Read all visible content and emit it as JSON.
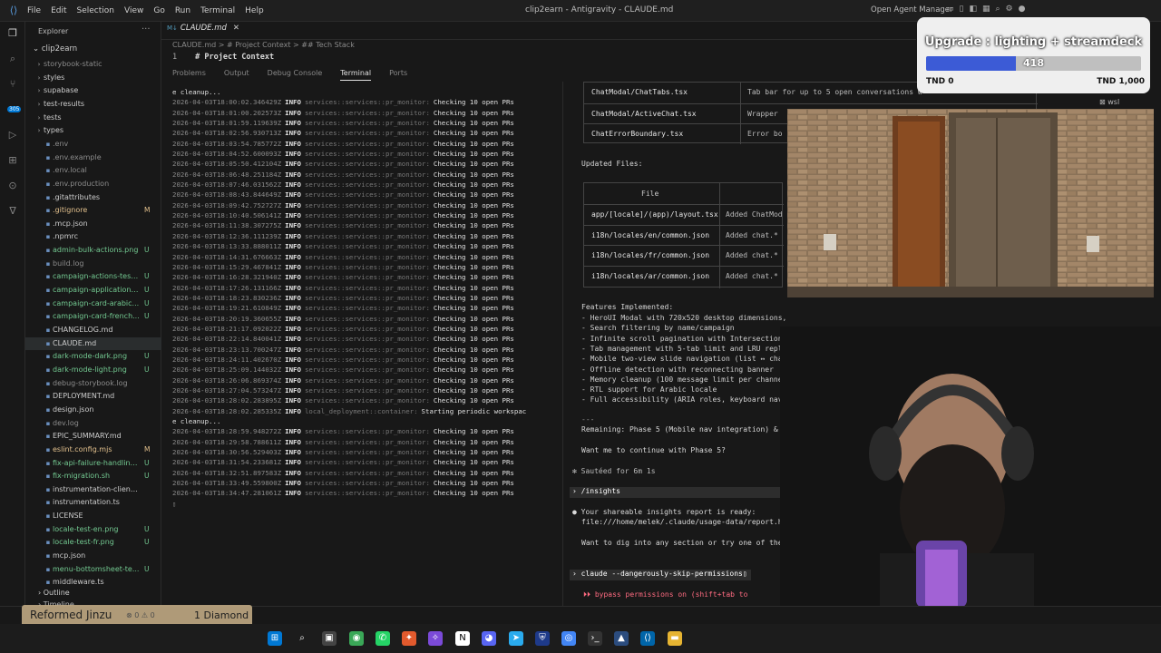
{
  "titlebar": {
    "menu": [
      "File",
      "Edit",
      "Selection",
      "View",
      "Go",
      "Run",
      "Terminal",
      "Help"
    ],
    "window_title": "clip2earn - Antigravity - CLAUDE.md",
    "open_agent_manager": "Open Agent Manager"
  },
  "activity": {
    "badge": "305"
  },
  "sidebar": {
    "header": "Explorer",
    "root": "clip2earn",
    "items": [
      {
        "label": "storybook-static",
        "kind": "folder",
        "status": ""
      },
      {
        "label": "styles",
        "kind": "folder",
        "status": ""
      },
      {
        "label": "supabase",
        "kind": "folder",
        "status": ""
      },
      {
        "label": "test-results",
        "kind": "folder",
        "status": ""
      },
      {
        "label": "tests",
        "kind": "folder",
        "status": ""
      },
      {
        "label": "types",
        "kind": "folder",
        "status": ""
      },
      {
        "label": ".env",
        "kind": "file",
        "status": ""
      },
      {
        "label": ".env.example",
        "kind": "file",
        "status": ""
      },
      {
        "label": ".env.local",
        "kind": "file",
        "status": ""
      },
      {
        "label": ".env.production",
        "kind": "file",
        "status": ""
      },
      {
        "label": ".gitattributes",
        "kind": "file",
        "status": ""
      },
      {
        "label": ".gitignore",
        "kind": "file",
        "status": "M"
      },
      {
        "label": ".mcp.json",
        "kind": "file",
        "status": ""
      },
      {
        "label": ".npmrc",
        "kind": "file",
        "status": ""
      },
      {
        "label": "admin-bulk-actions.png",
        "kind": "file",
        "status": "U"
      },
      {
        "label": "build.log",
        "kind": "file",
        "status": ""
      },
      {
        "label": "campaign-actions-test...",
        "kind": "file",
        "status": "U"
      },
      {
        "label": "campaign-application-...",
        "kind": "file",
        "status": "U"
      },
      {
        "label": "campaign-card-arabic...",
        "kind": "file",
        "status": "U"
      },
      {
        "label": "campaign-card-french...",
        "kind": "file",
        "status": "U"
      },
      {
        "label": "CHANGELOG.md",
        "kind": "file",
        "status": ""
      },
      {
        "label": "CLAUDE.md",
        "kind": "file",
        "status": ""
      },
      {
        "label": "dark-mode-dark.png",
        "kind": "file",
        "status": "U"
      },
      {
        "label": "dark-mode-light.png",
        "kind": "file",
        "status": "U"
      },
      {
        "label": "debug-storybook.log",
        "kind": "file",
        "status": ""
      },
      {
        "label": "DEPLOYMENT.md",
        "kind": "file",
        "status": ""
      },
      {
        "label": "design.json",
        "kind": "file",
        "status": ""
      },
      {
        "label": "dev.log",
        "kind": "file",
        "status": ""
      },
      {
        "label": "EPIC_SUMMARY.md",
        "kind": "file",
        "status": ""
      },
      {
        "label": "eslint.config.mjs",
        "kind": "file",
        "status": "M"
      },
      {
        "label": "fix-api-failure-handling.md",
        "kind": "file",
        "status": "U"
      },
      {
        "label": "fix-migration.sh",
        "kind": "file",
        "status": "U"
      },
      {
        "label": "instrumentation-client.ts",
        "kind": "file",
        "status": ""
      },
      {
        "label": "instrumentation.ts",
        "kind": "file",
        "status": ""
      },
      {
        "label": "LICENSE",
        "kind": "file",
        "status": ""
      },
      {
        "label": "locale-test-en.png",
        "kind": "file",
        "status": "U"
      },
      {
        "label": "locale-test-fr.png",
        "kind": "file",
        "status": "U"
      },
      {
        "label": "mcp.json",
        "kind": "file",
        "status": ""
      },
      {
        "label": "menu-bottomsheet-te...",
        "kind": "file",
        "status": "U"
      },
      {
        "label": "middleware.ts",
        "kind": "file",
        "status": ""
      }
    ],
    "outline": "Outline",
    "timeline": "Timeline"
  },
  "editor": {
    "tab": "CLAUDE.md",
    "breadcrumb": "CLAUDE.md  >  # Project Context  >  ## Tech Stack",
    "line_no": "1",
    "line_text": "# Project Context"
  },
  "panel": {
    "tabs": [
      "Problems",
      "Output",
      "Debug Console",
      "Terminal",
      "Ports"
    ],
    "log_lines": [
      {
        "plain": "e cleanup..."
      },
      {
        "ts": "2026-04-03T18:00:02.346429Z",
        "lvl": "INFO",
        "mod": "services::services::pr_monitor:",
        "msg": "Checking 10 open PRs"
      },
      {
        "ts": "2026-04-03T18:01:00.202573Z",
        "lvl": "INFO",
        "mod": "services::services::pr_monitor:",
        "msg": "Checking 10 open PRs"
      },
      {
        "ts": "2026-04-03T18:01:59.119639Z",
        "lvl": "INFO",
        "mod": "services::services::pr_monitor:",
        "msg": "Checking 10 open PRs"
      },
      {
        "ts": "2026-04-03T18:02:56.930713Z",
        "lvl": "INFO",
        "mod": "services::services::pr_monitor:",
        "msg": "Checking 10 open PRs"
      },
      {
        "ts": "2026-04-03T18:03:54.785772Z",
        "lvl": "INFO",
        "mod": "services::services::pr_monitor:",
        "msg": "Checking 10 open PRs"
      },
      {
        "ts": "2026-04-03T18:04:52.600093Z",
        "lvl": "INFO",
        "mod": "services::services::pr_monitor:",
        "msg": "Checking 10 open PRs"
      },
      {
        "ts": "2026-04-03T18:05:50.412104Z",
        "lvl": "INFO",
        "mod": "services::services::pr_monitor:",
        "msg": "Checking 10 open PRs"
      },
      {
        "ts": "2026-04-03T18:06:48.251184Z",
        "lvl": "INFO",
        "mod": "services::services::pr_monitor:",
        "msg": "Checking 10 open PRs"
      },
      {
        "ts": "2026-04-03T18:07:46.031562Z",
        "lvl": "INFO",
        "mod": "services::services::pr_monitor:",
        "msg": "Checking 10 open PRs"
      },
      {
        "ts": "2026-04-03T18:08:43.844649Z",
        "lvl": "INFO",
        "mod": "services::services::pr_monitor:",
        "msg": "Checking 10 open PRs"
      },
      {
        "ts": "2026-04-03T18:09:42.752727Z",
        "lvl": "INFO",
        "mod": "services::services::pr_monitor:",
        "msg": "Checking 10 open PRs"
      },
      {
        "ts": "2026-04-03T18:10:40.506141Z",
        "lvl": "INFO",
        "mod": "services::services::pr_monitor:",
        "msg": "Checking 10 open PRs"
      },
      {
        "ts": "2026-04-03T18:11:38.307275Z",
        "lvl": "INFO",
        "mod": "services::services::pr_monitor:",
        "msg": "Checking 10 open PRs"
      },
      {
        "ts": "2026-04-03T18:12:36.111239Z",
        "lvl": "INFO",
        "mod": "services::services::pr_monitor:",
        "msg": "Checking 10 open PRs"
      },
      {
        "ts": "2026-04-03T18:13:33.888011Z",
        "lvl": "INFO",
        "mod": "services::services::pr_monitor:",
        "msg": "Checking 10 open PRs"
      },
      {
        "ts": "2026-04-03T18:14:31.676663Z",
        "lvl": "INFO",
        "mod": "services::services::pr_monitor:",
        "msg": "Checking 10 open PRs"
      },
      {
        "ts": "2026-04-03T18:15:29.467841Z",
        "lvl": "INFO",
        "mod": "services::services::pr_monitor:",
        "msg": "Checking 10 open PRs"
      },
      {
        "ts": "2026-04-03T18:16:28.321940Z",
        "lvl": "INFO",
        "mod": "services::services::pr_monitor:",
        "msg": "Checking 10 open PRs"
      },
      {
        "ts": "2026-04-03T18:17:26.131166Z",
        "lvl": "INFO",
        "mod": "services::services::pr_monitor:",
        "msg": "Checking 10 open PRs"
      },
      {
        "ts": "2026-04-03T18:18:23.830236Z",
        "lvl": "INFO",
        "mod": "services::services::pr_monitor:",
        "msg": "Checking 10 open PRs"
      },
      {
        "ts": "2026-04-03T18:19:21.610849Z",
        "lvl": "INFO",
        "mod": "services::services::pr_monitor:",
        "msg": "Checking 10 open PRs"
      },
      {
        "ts": "2026-04-03T18:20:19.360655Z",
        "lvl": "INFO",
        "mod": "services::services::pr_monitor:",
        "msg": "Checking 10 open PRs"
      },
      {
        "ts": "2026-04-03T18:21:17.092022Z",
        "lvl": "INFO",
        "mod": "services::services::pr_monitor:",
        "msg": "Checking 10 open PRs"
      },
      {
        "ts": "2026-04-03T18:22:14.840041Z",
        "lvl": "INFO",
        "mod": "services::services::pr_monitor:",
        "msg": "Checking 10 open PRs"
      },
      {
        "ts": "2026-04-03T18:23:13.700247Z",
        "lvl": "INFO",
        "mod": "services::services::pr_monitor:",
        "msg": "Checking 10 open PRs"
      },
      {
        "ts": "2026-04-03T18:24:11.402670Z",
        "lvl": "INFO",
        "mod": "services::services::pr_monitor:",
        "msg": "Checking 10 open PRs"
      },
      {
        "ts": "2026-04-03T18:25:09.144032Z",
        "lvl": "INFO",
        "mod": "services::services::pr_monitor:",
        "msg": "Checking 10 open PRs"
      },
      {
        "ts": "2026-04-03T18:26:06.869374Z",
        "lvl": "INFO",
        "mod": "services::services::pr_monitor:",
        "msg": "Checking 10 open PRs"
      },
      {
        "ts": "2026-04-03T18:27:04.573247Z",
        "lvl": "INFO",
        "mod": "services::services::pr_monitor:",
        "msg": "Checking 10 open PRs"
      },
      {
        "ts": "2026-04-03T18:28:02.283895Z",
        "lvl": "INFO",
        "mod": "services::services::pr_monitor:",
        "msg": "Checking 10 open PRs"
      },
      {
        "ts": "2026-04-03T18:28:02.285335Z",
        "lvl": "INFO",
        "mod": "local_deployment::container:",
        "msg": "Starting periodic workspac"
      },
      {
        "plain": "e cleanup..."
      },
      {
        "ts": "2026-04-03T18:28:59.948272Z",
        "lvl": "INFO",
        "mod": "services::services::pr_monitor:",
        "msg": "Checking 10 open PRs"
      },
      {
        "ts": "2026-04-03T18:29:58.788611Z",
        "lvl": "INFO",
        "mod": "services::services::pr_monitor:",
        "msg": "Checking 10 open PRs"
      },
      {
        "ts": "2026-04-03T18:30:56.529403Z",
        "lvl": "INFO",
        "mod": "services::services::pr_monitor:",
        "msg": "Checking 10 open PRs"
      },
      {
        "ts": "2026-04-03T18:31:54.233681Z",
        "lvl": "INFO",
        "mod": "services::services::pr_monitor:",
        "msg": "Checking 10 open PRs"
      },
      {
        "ts": "2026-04-03T18:32:51.897583Z",
        "lvl": "INFO",
        "mod": "services::services::pr_monitor:",
        "msg": "Checking 10 open PRs"
      },
      {
        "ts": "2026-04-03T18:33:49.559800Z",
        "lvl": "INFO",
        "mod": "services::services::pr_monitor:",
        "msg": "Checking 10 open PRs"
      },
      {
        "ts": "2026-04-03T18:34:47.281061Z",
        "lvl": "INFO",
        "mod": "services::services::pr_monitor:",
        "msg": "Checking 10 open PRs"
      },
      {
        "plain": "▯"
      }
    ]
  },
  "claude": {
    "components_rows": [
      {
        "file": "ChatModal/ChatTabs.tsx",
        "desc": "Tab bar for up to 5 open conversations w"
      },
      {
        "file": "ChatModal/ActiveChat.tsx",
        "desc": "Wrapper"
      },
      {
        "file": "ChatErrorBoundary.tsx",
        "desc": "Error bo"
      }
    ],
    "updated_files_title": "Updated Files:",
    "updated_header": "File",
    "updated_rows": [
      {
        "file": "app/[locale]/(app)/layout.tsx",
        "desc": "Added ChatMod"
      },
      {
        "file": "i18n/locales/en/common.json",
        "desc": "Added chat.*"
      },
      {
        "file": "i18n/locales/fr/common.json",
        "desc": "Added chat.*"
      },
      {
        "file": "i18n/locales/ar/common.json",
        "desc": "Added chat.*"
      }
    ],
    "features_title": "Features Implemented:",
    "features": [
      "- HeroUI Modal with 720x520 desktop dimensions,",
      "- Search filtering by name/campaign",
      "- Infinite scroll pagination with IntersectionObserver",
      "- Tab management with 5-tab limit and LRU replacement",
      "- Mobile two-view slide navigation (list ↔ chat)",
      "- Offline detection with reconnecting banner",
      "- Memory cleanup (100 message limit per channel)",
      "- RTL support for Arabic locale",
      "- Full accessibility (ARIA roles, keyboard navigation)"
    ],
    "separator": "---",
    "remaining": "Remaining: Phase 5 (Mobile nav integration) & Phase 6 (Admin dashboar",
    "continue": "Want me to continue with Phase 5?",
    "sauteed": "✻ Sautéed for 6m 1s",
    "insights_cmd": "/insights",
    "report_line1": "Your shareable insights report is ready:",
    "report_line2": "file:///home/melek/.claude/usage-data/report.html",
    "dig": "Want to dig into any section or try one of the su",
    "prompt_cmd": "claude --dangerously-skip-permissions",
    "bypass": "bypass permissions on (shift+tab to"
  },
  "upgrade": {
    "title": "Upgrade : lighting + streamdeck",
    "value": "418",
    "fraction": 0.418,
    "min_label": "TND 0",
    "max_label": "TND 1,000"
  },
  "terminal_label": "wsl",
  "overlay": {
    "name": "Reformed Jinzu",
    "diamond": "1 Diamond",
    "stats": "⊗ 0 ⚠ 0"
  },
  "colors": {
    "accent": "#0078d4",
    "bar_fill": "#3c5bd6",
    "overlay": "#c4ad86"
  }
}
